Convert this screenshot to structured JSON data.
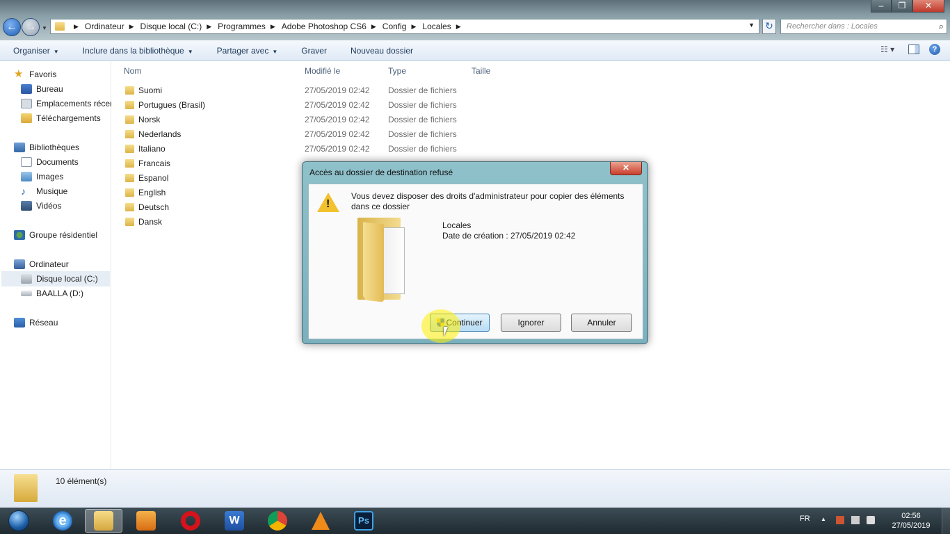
{
  "window": {
    "breadcrumb": [
      "Ordinateur",
      "Disque local (C:)",
      "Programmes",
      "Adobe Photoshop CS6",
      "Config",
      "Locales"
    ],
    "search_placeholder": "Rechercher dans : Locales"
  },
  "toolbar": {
    "organize": "Organiser",
    "include_library": "Inclure dans la bibliothèque",
    "share_with": "Partager avec",
    "burn": "Graver",
    "new_folder": "Nouveau dossier"
  },
  "sidebar": {
    "favorites": "Favoris",
    "desktop": "Bureau",
    "recent_places": "Emplacements récents",
    "downloads": "Téléchargements",
    "libraries": "Bibliothèques",
    "documents": "Documents",
    "pictures": "Images",
    "music": "Musique",
    "videos": "Vidéos",
    "homegroup": "Groupe résidentiel",
    "computer": "Ordinateur",
    "local_disk": "Disque local (C:)",
    "drive_d": "BAALLA (D:)",
    "network": "Réseau"
  },
  "columns": {
    "name": "Nom",
    "modified": "Modifié le",
    "type": "Type",
    "size": "Taille"
  },
  "files": [
    {
      "name": "Suomi",
      "date": "27/05/2019 02:42",
      "type": "Dossier de fichiers"
    },
    {
      "name": "Portugues (Brasil)",
      "date": "27/05/2019 02:42",
      "type": "Dossier de fichiers"
    },
    {
      "name": "Norsk",
      "date": "27/05/2019 02:42",
      "type": "Dossier de fichiers"
    },
    {
      "name": "Nederlands",
      "date": "27/05/2019 02:42",
      "type": "Dossier de fichiers"
    },
    {
      "name": "Italiano",
      "date": "27/05/2019 02:42",
      "type": "Dossier de fichiers"
    },
    {
      "name": "Francais",
      "date": "",
      "type": ""
    },
    {
      "name": "Espanol",
      "date": "",
      "type": ""
    },
    {
      "name": "English",
      "date": "",
      "type": ""
    },
    {
      "name": "Deutsch",
      "date": "",
      "type": ""
    },
    {
      "name": "Dansk",
      "date": "",
      "type": ""
    }
  ],
  "status": {
    "count": "10 élément(s)"
  },
  "dialog": {
    "title": "Accès au dossier de destination refusé",
    "message": "Vous devez disposer des droits d'administrateur pour copier des éléments dans ce dossier",
    "folder_name": "Locales",
    "creation_date": "Date de création : 27/05/2019 02:42",
    "continue": "Continuer",
    "ignore": "Ignorer",
    "cancel": "Annuler"
  },
  "taskbar": {
    "lang": "FR",
    "time": "02:56",
    "date": "27/05/2019"
  }
}
